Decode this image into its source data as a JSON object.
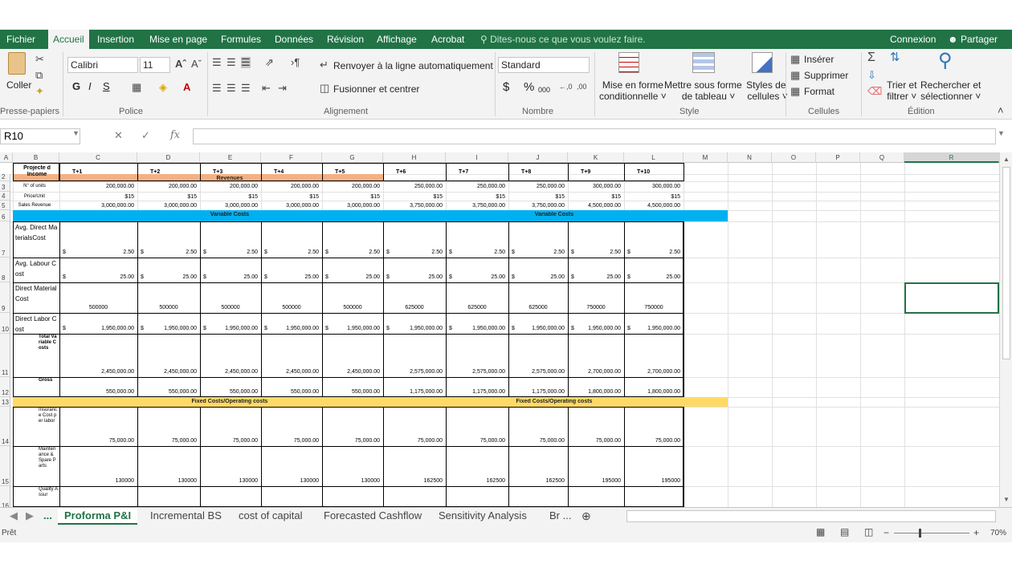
{
  "menu": {
    "tabs": [
      "Fichier",
      "Accueil",
      "Insertion",
      "Mise en page",
      "Formules",
      "Données",
      "Révision",
      "Affichage",
      "Acrobat"
    ],
    "tell_me": "Dites-nous ce que vous voulez faire.",
    "sign_in": "Connexion",
    "share": "Partager"
  },
  "ribbon": {
    "clipboard": {
      "paste": "Coller",
      "label": "Presse-papiers"
    },
    "font": {
      "name": "Calibri",
      "size": "11",
      "bold": "G",
      "italic": "I",
      "underline": "S",
      "label": "Police"
    },
    "alignment": {
      "wrap": "Renvoyer à la ligne automatiquement",
      "merge": "Fusionner et centrer",
      "label": "Alignement"
    },
    "number": {
      "format": "Standard",
      "currency": "$",
      "percent": "%",
      "thousands": "000",
      "label": "Nombre"
    },
    "style": {
      "conditional_1": "Mise en forme",
      "conditional_2": "conditionnelle",
      "table_1": "Mettre sous forme",
      "table_2": "de tableau",
      "cellstyles_1": "Styles de",
      "cellstyles_2": "cellules",
      "label": "Style"
    },
    "cells": {
      "insert": "Insérer",
      "delete": "Supprimer",
      "format": "Format",
      "label": "Cellules"
    },
    "editing": {
      "sort_1": "Trier et",
      "sort_2": "filtrer",
      "find_1": "Rechercher et",
      "find_2": "sélectionner",
      "label": "Édition"
    }
  },
  "formula_bar": {
    "name_box": "R10",
    "fx": "fx",
    "value": ""
  },
  "columns": [
    "A",
    "B",
    "C",
    "D",
    "E",
    "F",
    "G",
    "H",
    "I",
    "J",
    "K",
    "L",
    "M",
    "N",
    "O",
    "P",
    "Q",
    "R"
  ],
  "row_numbers": [
    "2",
    "3",
    "4",
    "5",
    "6",
    "7",
    "8",
    "9",
    "10",
    "11",
    "12",
    "13",
    "14",
    "15",
    "16"
  ],
  "sheet": {
    "header_label": "Projecte d Income",
    "periods": [
      "T+1",
      "T+2",
      "T+3",
      "T+4",
      "T+5",
      "T+6",
      "T+7",
      "T+8",
      "T+9",
      "T+10"
    ],
    "revenues_banner": "Revenues",
    "variable_banner": "Variable Costs",
    "fixed_banner": "Fixed Costs/Operating costs",
    "rows": {
      "units": {
        "label": "N° of units",
        "values": [
          "200,000.00",
          "200,000.00",
          "200,000.00",
          "200,000.00",
          "200,000.00",
          "250,000.00",
          "250,000.00",
          "250,000.00",
          "300,000.00",
          "300,000.00"
        ]
      },
      "price": {
        "label": "Price/Unit",
        "values": [
          "$15",
          "$15",
          "$15",
          "$15",
          "$15",
          "$15",
          "$15",
          "$15",
          "$15",
          "$15"
        ]
      },
      "sales": {
        "label": "Sales Revenue",
        "values": [
          "3,000,000.00",
          "3,000,000.00",
          "3,000,000.00",
          "3,000,000.00",
          "3,000,000.00",
          "3,750,000.00",
          "3,750,000.00",
          "3,750,000.00",
          "4,500,000.00",
          "4,500,000.00"
        ]
      },
      "avg_material": {
        "label": "Avg. Direct MaterialsCost",
        "currency": "$",
        "values": [
          "2.50",
          "2.50",
          "2.50",
          "2.50",
          "2.50",
          "2.50",
          "2.50",
          "2.50",
          "2.50",
          "2.50"
        ]
      },
      "avg_labour": {
        "label": "Avg. Labour Cost",
        "currency": "$",
        "values": [
          "25.00",
          "25.00",
          "25.00",
          "25.00",
          "25.00",
          "25.00",
          "25.00",
          "25.00",
          "25.00",
          "25.00"
        ]
      },
      "direct_material": {
        "label": "Direct Material Cost",
        "values": [
          "500000",
          "500000",
          "500000",
          "500000",
          "500000",
          "625000",
          "625000",
          "625000",
          "750000",
          "750000"
        ]
      },
      "direct_labor": {
        "label": "Direct Labor Cost",
        "currency": "$",
        "values": [
          "1,950,000.00",
          "1,950,000.00",
          "1,950,000.00",
          "1,950,000.00",
          "1,950,000.00",
          "1,950,000.00",
          "1,950,000.00",
          "1,950,000.00",
          "1,950,000.00",
          "1,950,000.00"
        ]
      },
      "total_variable": {
        "label": "Total Variable Costs",
        "values": [
          "2,450,000.00",
          "2,450,000.00",
          "2,450,000.00",
          "2,450,000.00",
          "2,450,000.00",
          "2,575,000.00",
          "2,575,000.00",
          "2,575,000.00",
          "2,700,000.00",
          "2,700,000.00"
        ]
      },
      "gross": {
        "label": "Gross",
        "values": [
          "550,000.00",
          "550,000.00",
          "550,000.00",
          "550,000.00",
          "550,000.00",
          "1,175,000.00",
          "1,175,000.00",
          "1,175,000.00",
          "1,800,000.00",
          "1,800,000.00"
        ]
      },
      "insurance": {
        "label": "Insurance Cost per labor",
        "values": [
          "75,000.00",
          "75,000.00",
          "75,000.00",
          "75,000.00",
          "75,000.00",
          "75,000.00",
          "75,000.00",
          "75,000.00",
          "75,000.00",
          "75,000.00"
        ]
      },
      "maintenance": {
        "label": "Maintenance & Spare Parts",
        "values": [
          "130000",
          "130000",
          "130000",
          "130000",
          "130000",
          "162500",
          "162500",
          "162500",
          "195000",
          "195000"
        ]
      },
      "quality": {
        "label": "Quality Assur"
      }
    }
  },
  "sheet_tabs": [
    "Proforma P&I",
    "Incremental BS",
    "cost of capital",
    "Forecasted Cashflow",
    "Sensitivity Analysis",
    "Br ..."
  ],
  "status": {
    "ready": "Prêt",
    "zoom": "70%"
  },
  "colors": {
    "excel_green": "#217346",
    "revenue_band": "#f4b183",
    "variable_band": "#00b0f0",
    "fixed_band": "#ffd966"
  }
}
